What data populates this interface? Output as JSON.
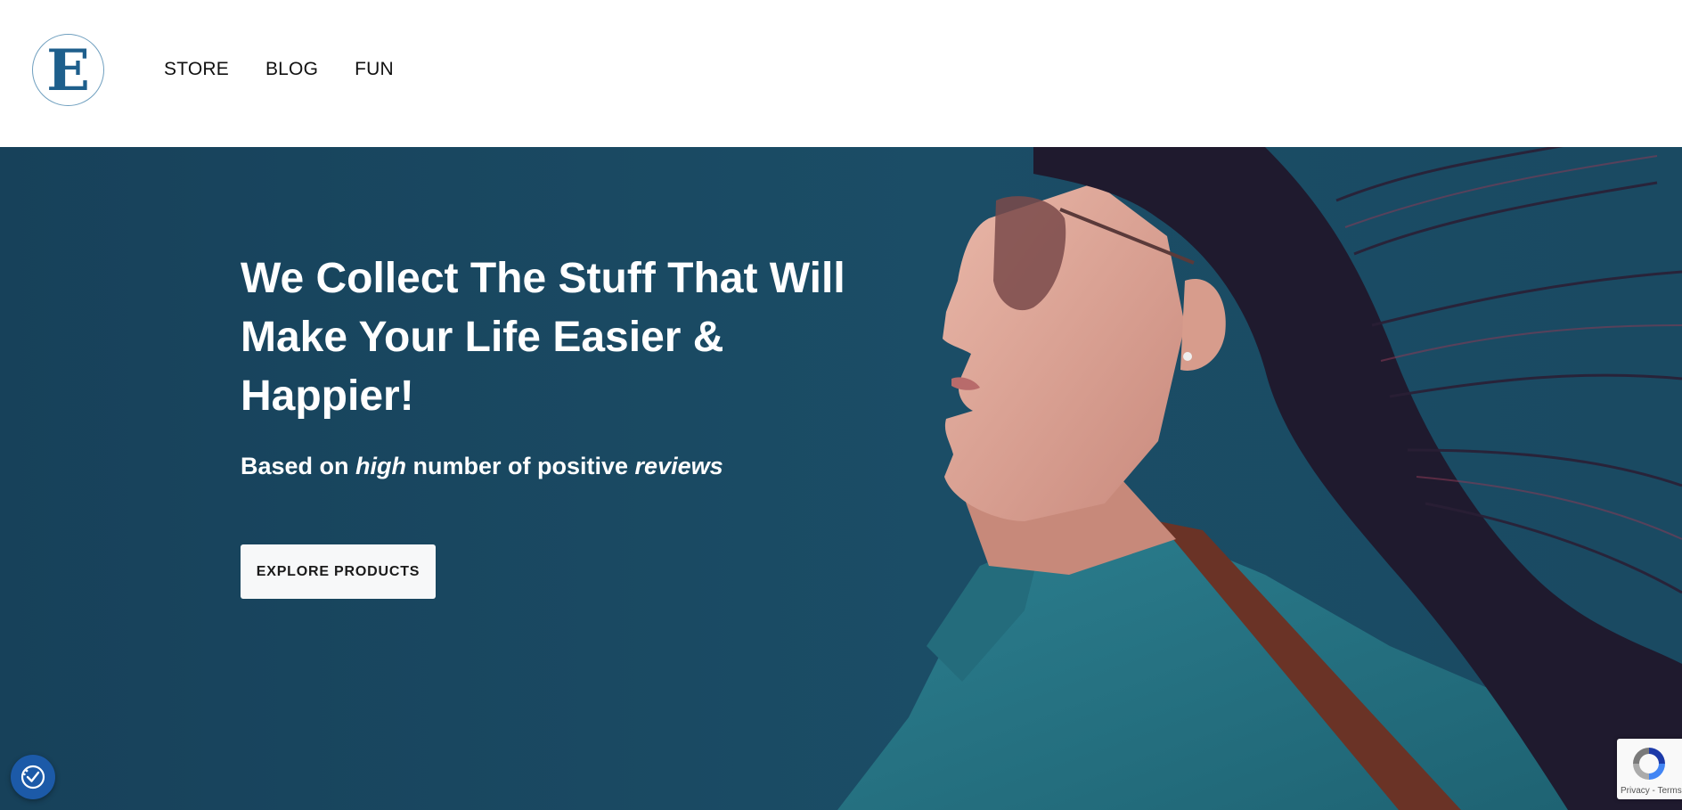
{
  "header": {
    "logo_letter": "E",
    "nav": [
      "STORE",
      "BLOG",
      "FUN"
    ]
  },
  "hero": {
    "headline": "We Collect The Stuff That Will Make Your Life Easier & Happier!",
    "subline": {
      "part1": "Based on ",
      "em1": "high",
      "part2": " number of positive ",
      "em2": "reviews"
    },
    "cta_label": "EXPLORE PRODUCTS",
    "background_color": "#1a4a63"
  },
  "widgets": {
    "accessibility_icon": "accessibility-icon",
    "recaptcha_text": "Privacy - Terms"
  },
  "colors": {
    "brand": "#1e5f8c",
    "hero_bg": "#1a4a63",
    "cta_bg": "#f7f8f9"
  }
}
